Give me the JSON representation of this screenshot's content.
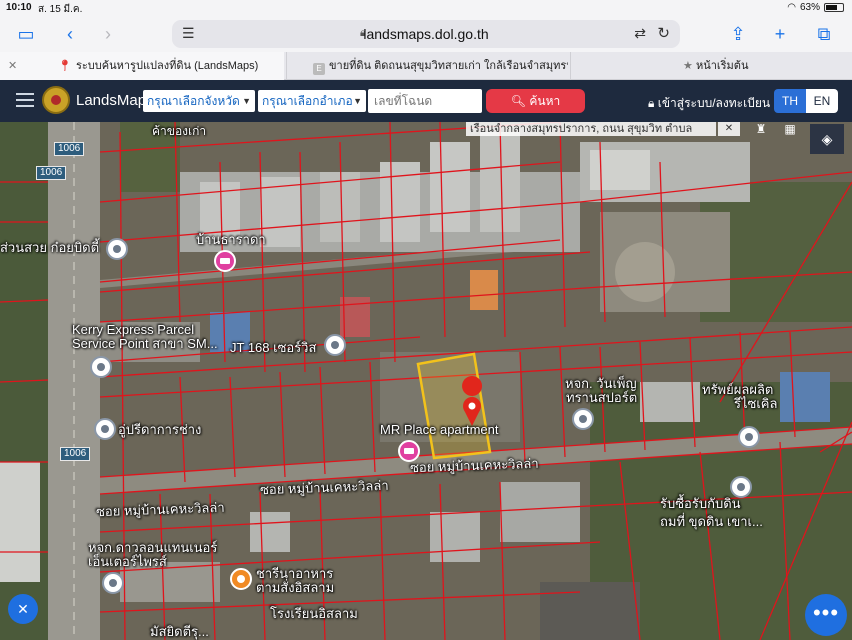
{
  "status": {
    "time": "10:10",
    "date": "ส. 15 มี.ค.",
    "battery": "63%"
  },
  "browser": {
    "url": "landsmaps.dol.go.th",
    "tabs": [
      {
        "label": "ระบบค้นหารูปแปลงที่ดิน (LandsMaps)",
        "active": true
      },
      {
        "label": "ขายที่ดิน ติดถนนสุขุมวิทสายเก่า ใกล้เรือนจำสมุทรปราการ |...",
        "active": false
      },
      {
        "label": "หน้าเริ่มต้น",
        "active": false
      }
    ],
    "tab2_icon": "E"
  },
  "app": {
    "brand": "LandsMaps",
    "province_placeholder": "กรุณาเลือกจังหวัด",
    "district_placeholder": "กรุณาเลือกอำเภอ",
    "deed_placeholder": "เลขที่โฉนด",
    "search_label": "ค้นหา",
    "login_label": "เข้าสู่ระบบ/ลงทะเบียน",
    "lang_th": "TH",
    "lang_en": "EN"
  },
  "map": {
    "overlay_text": "เรือนจำกลางสมุทรปราการ, ถนน สุขุมวิท ตำบล",
    "road_number": "1006",
    "labels": {
      "l1": "ค้าของเก่า",
      "l2": "บ้านธาราดา",
      "l3": "ส่วนสวย ก๋อยบิดตี้",
      "l4": "Kerry Express Parcel",
      "l5": "Service Point สาขา SM...",
      "l6": "JT 168 เซอร์วิส",
      "l7": "อู่ปรีดาการช่าง",
      "l8": "MR Place apartment",
      "l9": "หจก. วันเพ็ญ",
      "l10": "ทรานสปอร์ต",
      "l11": "ทรัพย์ผลผลิต",
      "l12": "รีไซเคิล",
      "l13": "ซอย หมู่บ้านเคหะวิลล่า",
      "l14": "ซอย หมู่บ้านเคหะวิลล่า",
      "l15": "ซอย หมู่บ้านเคหะวิลล่า",
      "l16": "รับซื้อรับกับดิน",
      "l17": "ถมที่ ขุดดิน เขาเ...",
      "l18": "หจก.ดาวลอนแทนเนอร์",
      "l19": "เอ็นเตอร์ไพรส์",
      "l20": "ชารีนาอาหาร",
      "l21": "ตามสั่งอิสลาม",
      "l22": "โรงเรียนอิสลาม",
      "l23": "มัสยิดตีรุ..."
    }
  }
}
